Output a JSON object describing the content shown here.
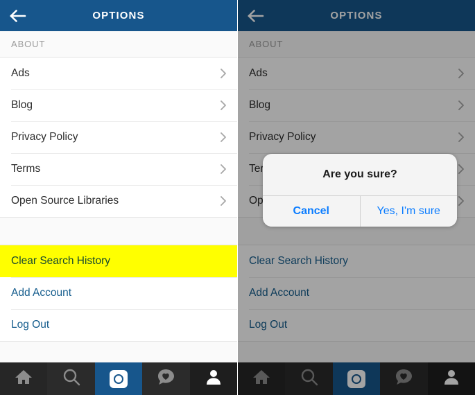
{
  "header": {
    "title": "OPTIONS",
    "back_icon": "arrow-left-icon",
    "bg_color": "#17568c"
  },
  "section": {
    "label": "ABOUT"
  },
  "about_items": [
    {
      "label": "Ads",
      "chevron": "chevron-right-icon"
    },
    {
      "label": "Blog",
      "chevron": "chevron-right-icon"
    },
    {
      "label": "Privacy Policy",
      "chevron": "chevron-right-icon"
    },
    {
      "label": "Terms",
      "chevron": "chevron-right-icon"
    },
    {
      "label": "Open Source Libraries",
      "chevron": "chevron-right-icon"
    }
  ],
  "account_items": [
    {
      "label": "Clear Search History",
      "highlighted": true,
      "highlight_color": "#ffff00"
    },
    {
      "label": "Add Account",
      "highlighted": false
    },
    {
      "label": "Log Out",
      "highlighted": false
    }
  ],
  "link_color": "#175e8e",
  "tabbar": {
    "tabs": [
      {
        "name": "home-icon",
        "active": false
      },
      {
        "name": "search-icon",
        "active": false
      },
      {
        "name": "camera-icon",
        "active": true
      },
      {
        "name": "activity-heart-icon",
        "active": false
      },
      {
        "name": "profile-icon",
        "active": false
      }
    ]
  },
  "dialog": {
    "title": "Are you sure?",
    "cancel_label": "Cancel",
    "confirm_label": "Yes, I'm sure",
    "button_color": "#0a7cff"
  }
}
